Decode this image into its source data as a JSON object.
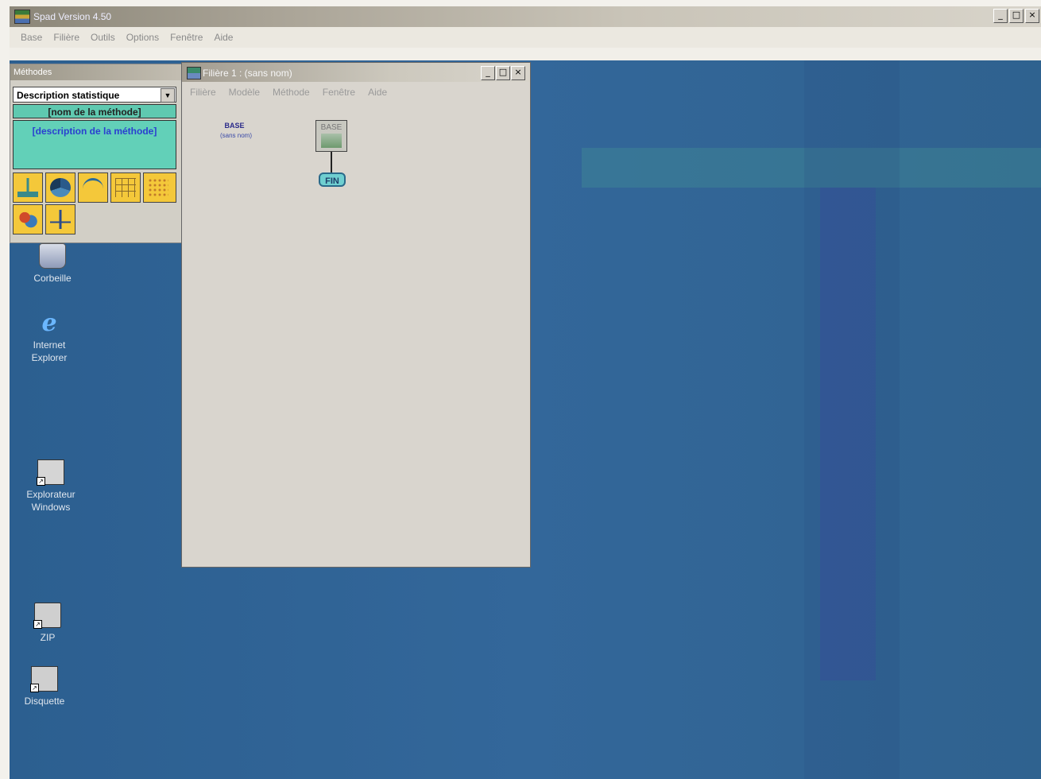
{
  "app": {
    "title": "Spad Version 4.50",
    "menu": [
      "Base",
      "Filière",
      "Outils",
      "Options",
      "Fenêtre",
      "Aide"
    ],
    "controls": {
      "minimize": "_",
      "maximize": "□",
      "close": "×"
    }
  },
  "methods_panel": {
    "title": "Méthodes",
    "select_value": "Description statistique",
    "method_name": "[nom de la méthode]",
    "method_description": "[description de la méthode]",
    "tools": [
      "histogram-icon",
      "pie-icon",
      "curve-icon",
      "grid-icon",
      "scatter-icon",
      "cluster-icon",
      "tree-icon"
    ]
  },
  "filiere_window": {
    "title": "Filière 1 : (sans nom)",
    "menu": [
      "Filière",
      "Modèle",
      "Méthode",
      "Fenêtre",
      "Aide"
    ],
    "controls": {
      "minimize": "_",
      "maximize": "□",
      "close": "×"
    },
    "base_label": "BASE",
    "base_sublabel": "(sans nom)",
    "node_base": "BASE",
    "node_fin": "FIN"
  },
  "desktop": {
    "icons": [
      {
        "label": "Corbeille",
        "icon": "recycle-bin-icon"
      },
      {
        "label": "Internet Explorer",
        "icon": "internet-explorer-icon"
      },
      {
        "label": "Explorateur Windows",
        "icon": "explorer-icon"
      },
      {
        "label": "ZIP",
        "icon": "zip-drive-icon"
      },
      {
        "label": "Disquette",
        "icon": "floppy-icon"
      }
    ]
  }
}
